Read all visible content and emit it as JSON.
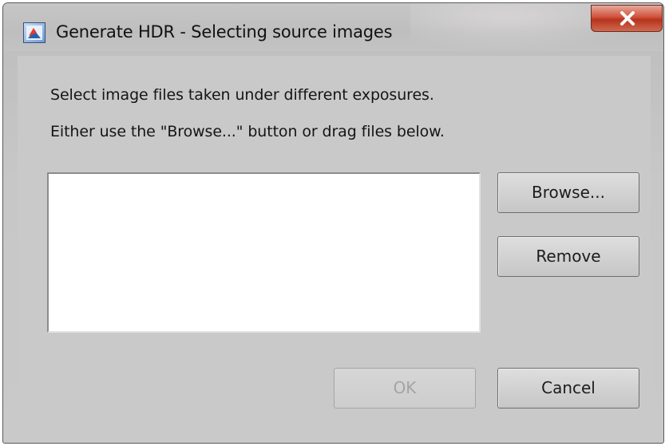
{
  "window": {
    "title": "Generate HDR - Selecting source images"
  },
  "instructions": {
    "line1": "Select image files taken under different exposures.",
    "line2": "Either use the \"Browse...\" button or drag files below."
  },
  "file_list": {
    "items": []
  },
  "buttons": {
    "browse": "Browse...",
    "remove": "Remove",
    "ok": "OK",
    "cancel": "Cancel"
  },
  "icons": {
    "app": "app-icon",
    "close": "close-icon"
  },
  "colors": {
    "dialog_background": "#c9c9c9",
    "close_button": "#c84a32",
    "disabled_text": "#a4a4a4"
  }
}
